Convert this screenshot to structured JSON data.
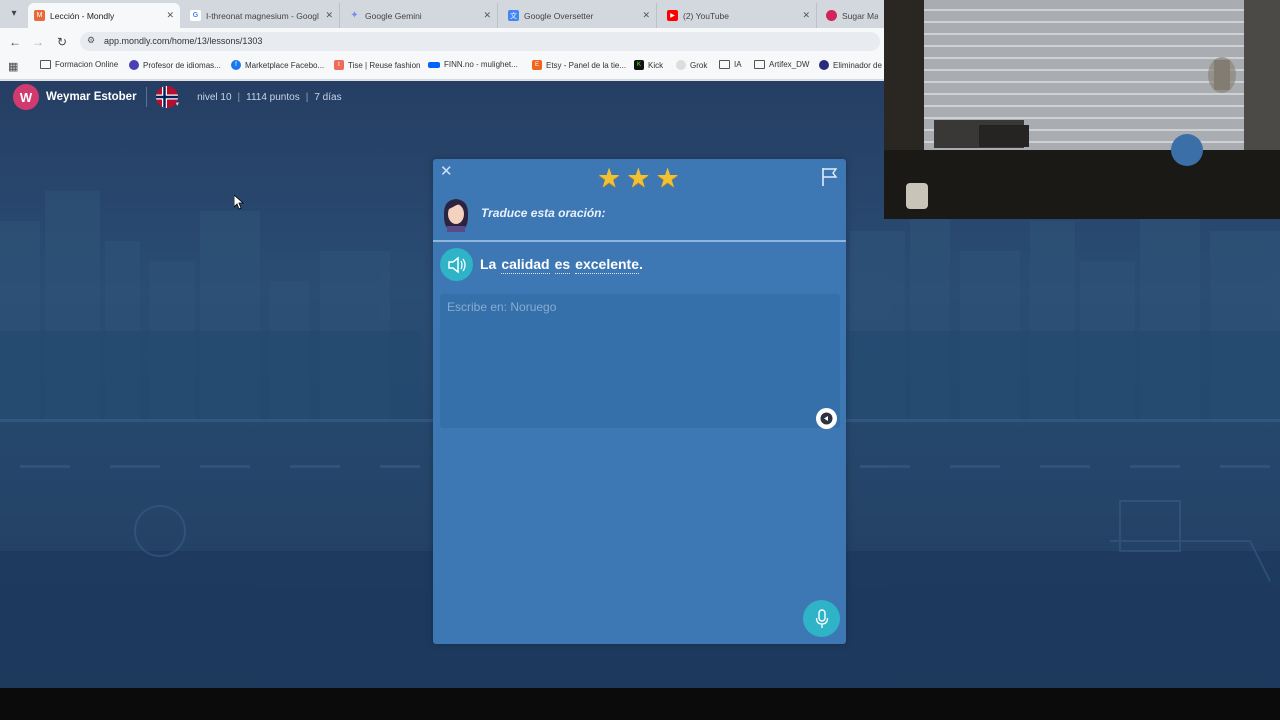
{
  "browser": {
    "tabs": [
      {
        "title": "Lección - Mondly",
        "favicon": "mondly-icon",
        "color": "#e86a3a",
        "active": true
      },
      {
        "title": "I-threonat magnesium - Googl",
        "favicon": "google-icon",
        "color": "#4285f4",
        "active": false
      },
      {
        "title": "Google Gemini",
        "favicon": "gemini-icon",
        "color": "#7b8cf0",
        "active": false
      },
      {
        "title": "Google Oversetter",
        "favicon": "translate-icon",
        "color": "#4285f4",
        "active": false
      },
      {
        "title": "(2) YouTube",
        "favicon": "youtube-icon",
        "color": "#ff0000",
        "active": false
      },
      {
        "title": "Sugar Mam",
        "favicon": "sugar-icon",
        "color": "#d1245a",
        "active": false
      }
    ],
    "url": "app.mondly.com/home/13/lessons/1303",
    "bookmarks": [
      {
        "label": "Formacion Online",
        "icon": "folder-icon"
      },
      {
        "label": "Profesor de idiomas...",
        "icon": "profesor-icon"
      },
      {
        "label": "Marketplace Facebo...",
        "icon": "facebook-icon"
      },
      {
        "label": "Tise | Reuse fashion",
        "icon": "tise-icon"
      },
      {
        "label": "FINN.no - mulighet...",
        "icon": "finn-icon"
      },
      {
        "label": "Etsy - Panel de la tie...",
        "icon": "etsy-icon"
      },
      {
        "label": "Kick",
        "icon": "kick-icon"
      },
      {
        "label": "Grok",
        "icon": "grok-icon"
      },
      {
        "label": "IA",
        "icon": "folder-icon"
      },
      {
        "label": "Artifex_DW",
        "icon": "folder-icon"
      },
      {
        "label": "Eliminador de",
        "icon": "eliminador-icon"
      }
    ]
  },
  "user": {
    "initial": "W",
    "name": "Weymar Estober",
    "flag": "norway-flag-icon",
    "level": "nivel 10",
    "points": "1114 puntos",
    "days": "7 días"
  },
  "lesson": {
    "stars": 3,
    "instruction": "Traduce esta oración:",
    "sentence": [
      {
        "text": "La",
        "hint": false
      },
      {
        "text": "calidad",
        "hint": true
      },
      {
        "text": "es",
        "hint": true
      },
      {
        "text": "excelente",
        "hint": true
      },
      {
        "text": ".",
        "hint": false
      }
    ],
    "answer_value": "",
    "answer_placeholder": "Escribe en: Noruego"
  },
  "colors": {
    "background": "#263e63",
    "card": "#3d78b5",
    "accent": "#2fb3c7",
    "star": "#f2c133",
    "avatar": "#d13a6f"
  }
}
